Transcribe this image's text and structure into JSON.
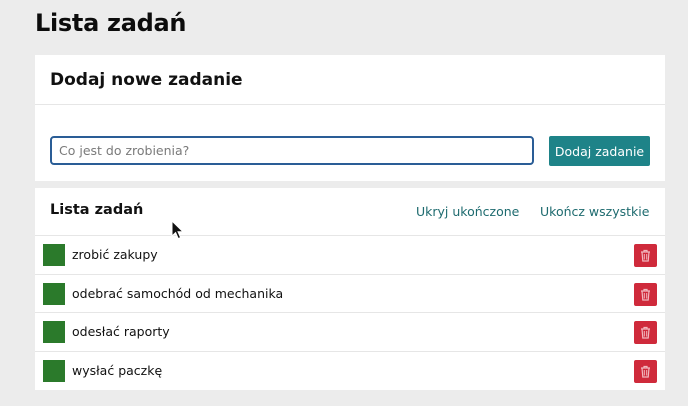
{
  "page": {
    "title": "Lista zadań"
  },
  "add_section": {
    "title": "Dodaj nowe zadanie",
    "input_placeholder": "Co jest do zrobienia?",
    "input_value": "",
    "button_label": "Dodaj zadanie"
  },
  "list_section": {
    "title": "Lista zadań",
    "hide_done_label": "Ukryj ukończone",
    "complete_all_label": "Ukończ wszystkie",
    "tasks": [
      {
        "text": "zrobić zakupy",
        "done": true
      },
      {
        "text": "odebrać samochód od mechanika",
        "done": true
      },
      {
        "text": "odesłać raporty",
        "done": true
      },
      {
        "text": "wysłać paczkę",
        "done": true
      }
    ]
  },
  "icons": {
    "delete": "trash-icon",
    "pointer": "mouse-cursor-icon"
  },
  "colors": {
    "accent": "#1e8388",
    "link": "#1e6b6f",
    "done_checkbox": "#2b7a2b",
    "delete_button": "#cf2a3b",
    "input_focus_border": "#2a5d96",
    "page_background": "#ececec"
  }
}
